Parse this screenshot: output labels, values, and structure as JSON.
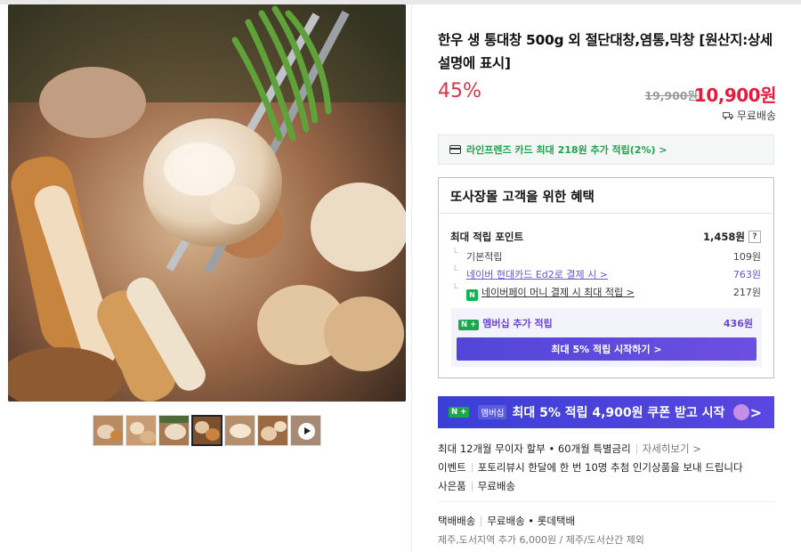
{
  "product": {
    "title": "한우 생 통대창 500g 외 절단대창,염통,막창 [원산지:상세설명에 표시]",
    "discount": "45%",
    "original_price": "19,900원",
    "price": "10,900원",
    "delivery_tag": "무료배송"
  },
  "card_promo": "라인프렌즈 카드 최대 218원 추가 적립(2%) >",
  "benefit": {
    "heading": "또사장몰 고객을 위한 혜택",
    "max_points_label": "최대 적립 포인트",
    "max_points_value": "1,458원",
    "help": "?",
    "rows": [
      {
        "label": "기본적립",
        "value": "109원"
      },
      {
        "label": "네이버 현대카드 Ed2로 결제 시 >",
        "value": "763원"
      },
      {
        "label": "네이버페이 머니 결제 시 최대 적립 >",
        "value": "217원",
        "badge": "N"
      }
    ],
    "membership_badge": "N +",
    "membership_label": "멤버십 추가 적립",
    "membership_value": "436원",
    "membership_button": "최대 5% 적립 시작하기 >"
  },
  "banner": {
    "badge": "N +",
    "sub": "멤버십",
    "text": "최대 5% 적립 4,900원 쿠폰 받고 시작",
    "chevron": ">"
  },
  "info": {
    "installment": "최대 12개월 무이자 할부 • 60개월 특별금리",
    "installment_link": "자세히보기 >",
    "event_label": "이벤트",
    "event_text": "포토리뷰시 한달에 한 번 10명 추첨 인기상품을 보내 드립니다",
    "gift_label": "사은품",
    "gift_text": "무료배송",
    "shipping_type": "택배배송",
    "shipping_fee": "무료배송 • 롯데택배",
    "shipping_extra": "제주,도서지역 추가 6,000원 / 제주/도서산간 제외"
  },
  "colors": {
    "accent_red": "#e41c3f",
    "discount_red": "#d2364a",
    "naver_green": "#1ea44c",
    "membership_purple": "#5a46e0"
  },
  "gallery": {
    "thumbnail_count": 7,
    "active_index": 3,
    "video_icon": "play-icon"
  }
}
